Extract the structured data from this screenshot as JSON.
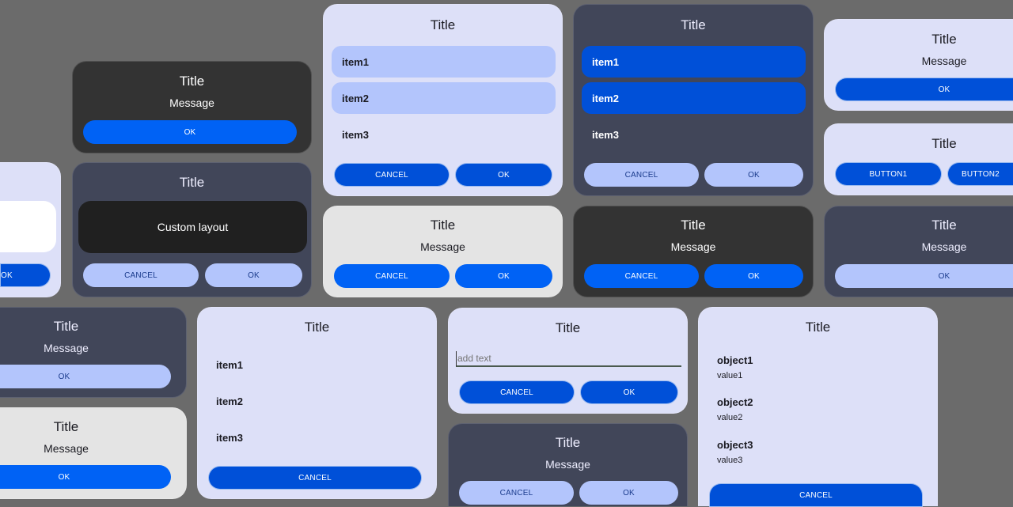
{
  "colors": {
    "background": "#6b6b6b",
    "light_surface": "#dde0f8",
    "gray_surface": "#e4e4e4",
    "dark_surface": "#333333",
    "slate_surface": "#414659",
    "primary": "#0050d8",
    "primary_bright": "#0062f5",
    "tonal": "#b3c5fc"
  },
  "title": "Title",
  "message": "Message",
  "ok": "OK",
  "cancel": "CANCEL",
  "custom_layout": "Custom layout",
  "buttons": {
    "button1": "BUTTON1",
    "button2": "BUTTON2"
  },
  "items": [
    "item1",
    "item2",
    "item3"
  ],
  "objects": [
    {
      "name": "object1",
      "value": "value1"
    },
    {
      "name": "object2",
      "value": "value2"
    },
    {
      "name": "object3",
      "value": "value3"
    }
  ],
  "input": {
    "placeholder": "add text"
  }
}
